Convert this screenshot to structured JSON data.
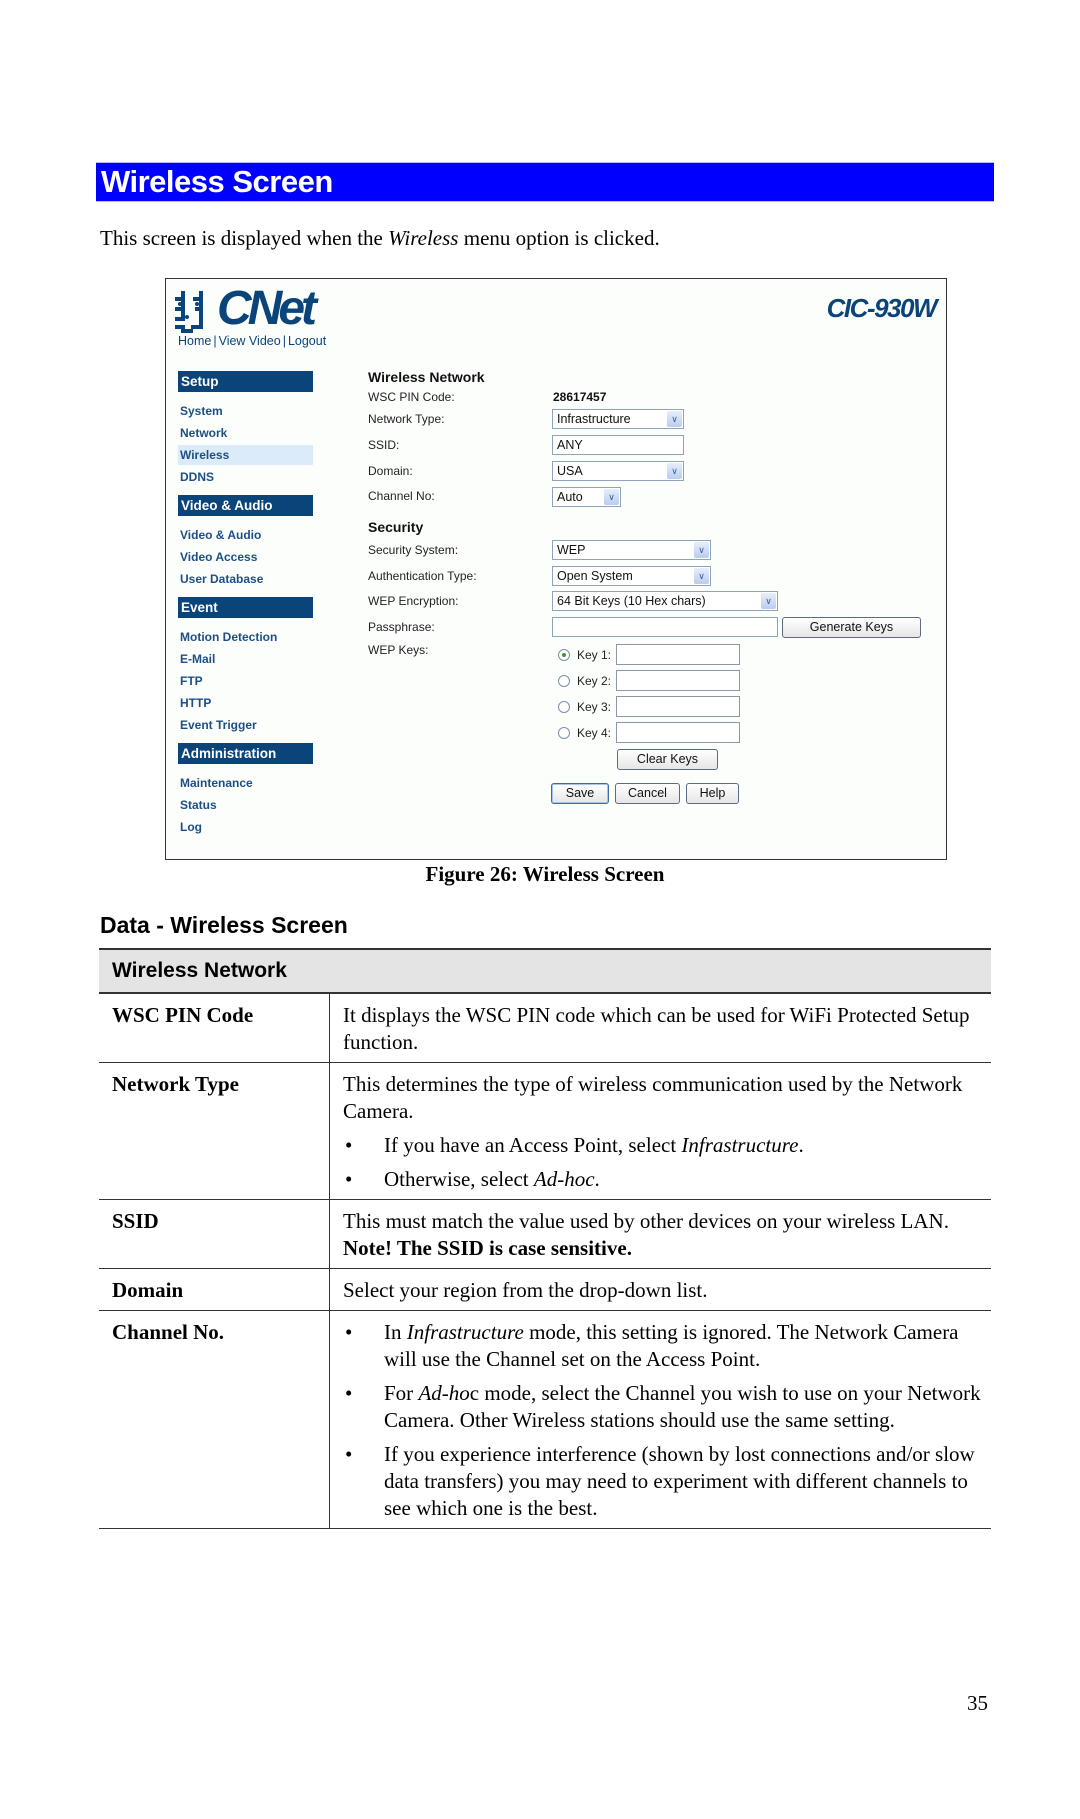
{
  "section": {
    "title": "Wireless Screen",
    "color": "#0000ff"
  },
  "intro": {
    "before": "This screen is displayed when the ",
    "italic": "Wireless",
    "after": " menu option is clicked."
  },
  "screenshot": {
    "brand": "CNet",
    "model": "CIC-930W",
    "brand_color": "#0a4478",
    "topnav": [
      "Home",
      "View Video",
      "Logout"
    ],
    "sidebar": [
      {
        "heading": "Setup",
        "items": [
          "System",
          "Network",
          "Wireless",
          "DDNS"
        ]
      },
      {
        "heading": "Video & Audio",
        "items": [
          "Video & Audio",
          "Video Access",
          "User Database"
        ]
      },
      {
        "heading": "Event",
        "items": [
          "Motion Detection",
          "E-Mail",
          "FTP",
          "HTTP",
          "Event Trigger"
        ]
      },
      {
        "heading": "Administration",
        "items": [
          "Maintenance",
          "Status",
          "Log"
        ]
      }
    ],
    "active_item": "Wireless",
    "wireless": {
      "heading": "Wireless Network",
      "pin_label": "WSC PIN Code:",
      "pin_value": "28617457",
      "network_type_label": "Network Type:",
      "network_type_value": "Infrastructure",
      "ssid_label": "SSID:",
      "ssid_value": "ANY",
      "domain_label": "Domain:",
      "domain_value": "USA",
      "channel_label": "Channel No:",
      "channel_value": "Auto"
    },
    "security": {
      "heading": "Security",
      "system_label": "Security System:",
      "system_value": "WEP",
      "auth_label": "Authentication Type:",
      "auth_value": "Open System",
      "encryption_label": "WEP Encryption:",
      "encryption_value": "64 Bit Keys (10 Hex chars)",
      "passphrase_label": "Passphrase:",
      "passphrase_value": "",
      "generate_button": "Generate Keys",
      "keys_label": "WEP Keys:",
      "keys": [
        {
          "label": "Key 1:",
          "value": "",
          "selected": true
        },
        {
          "label": "Key 2:",
          "value": "",
          "selected": false
        },
        {
          "label": "Key 3:",
          "value": "",
          "selected": false
        },
        {
          "label": "Key 4:",
          "value": "",
          "selected": false
        }
      ],
      "clear_button": "Clear Keys"
    },
    "buttons": {
      "save": "Save",
      "cancel": "Cancel",
      "help": "Help"
    }
  },
  "figure_caption": "Figure 26: Wireless Screen",
  "data_title": "Data - Wireless Screen",
  "table": {
    "header": "Wireless Network",
    "rows": [
      {
        "name": "WSC PIN Code",
        "text": "It displays the WSC PIN code which can be used for WiFi Protected Setup function."
      },
      {
        "name": "Network Type",
        "text": "This determines the type of wireless communication used by the Network Camera.",
        "bullets": [
          {
            "before": "If you have an Access Point, select ",
            "italic": "Infrastructure",
            "after": "."
          },
          {
            "before": "Otherwise, select ",
            "italic": "Ad-hoc",
            "after": "."
          }
        ]
      },
      {
        "name": "SSID",
        "text": "This must match the value used by other devices on your wireless LAN.",
        "note": "Note! The SSID is case sensitive."
      },
      {
        "name": "Domain",
        "text": "Select your region from the drop-down list."
      },
      {
        "name": "Channel No.",
        "bullets": [
          {
            "before": "In ",
            "italic": "Infrastructure",
            "after": " mode, this setting is ignored. The Network Camera will use the Channel set on the Access Point."
          },
          {
            "before": "For ",
            "italic": "Ad-ho",
            "after": "c mode, select the Channel you wish to use on your Network Camera. Other Wireless stations should use the same setting."
          },
          {
            "before": "If you experience interference (shown by lost connections and/or slow data transfers) you may need to experiment with different channels to see which one is the best.",
            "italic": "",
            "after": ""
          }
        ]
      }
    ]
  },
  "page_number": "35"
}
